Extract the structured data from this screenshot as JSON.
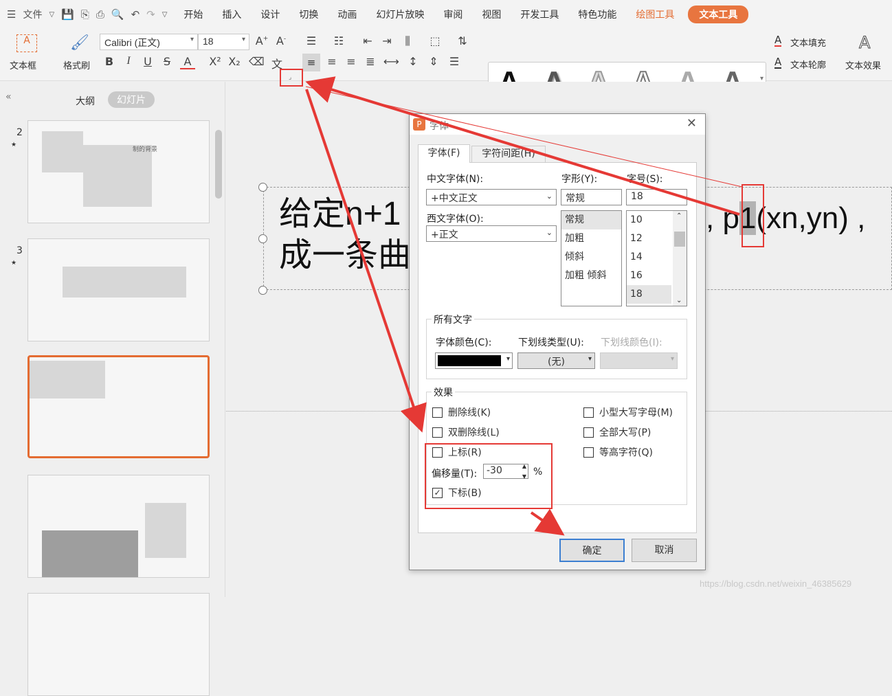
{
  "menu": {
    "file_label": "文件",
    "tabs": [
      "开始",
      "插入",
      "设计",
      "切换",
      "动画",
      "幻灯片放映",
      "审阅",
      "视图",
      "开发工具",
      "特色功能"
    ],
    "drawing_tools": "绘图工具",
    "text_tools": "文本工具"
  },
  "ribbon": {
    "textbox_label": "文本框",
    "format_painter_label": "格式刷",
    "font_name": "Calibri (正文)",
    "font_size": "18",
    "text_fill_label": "文本填充",
    "text_outline_label": "文本轮廓",
    "text_effect_label": "文本效果",
    "gallery_glyph": "A"
  },
  "sidebar": {
    "tab_outline": "大纲",
    "tab_slides": "幻灯片",
    "slide_numbers": [
      "2",
      "3"
    ],
    "thumb_caption": "制的背景"
  },
  "slide": {
    "line1": "给定n+1",
    "line1_tail": ", p",
    "line1_sub": "1",
    "line1_end": "(xn,yn) ,",
    "line2": "成一条曲"
  },
  "dialog": {
    "title": "字体",
    "tabs": [
      "字体(F)",
      "字符间距(H)"
    ],
    "cn_font_label": "中文字体(N):",
    "cn_font_value": "+中文正文",
    "west_font_label": "西文字体(O):",
    "west_font_value": "+正文",
    "style_label": "字形(Y):",
    "style_value": "常规",
    "style_options": [
      "常规",
      "加粗",
      "倾斜",
      "加粗 倾斜"
    ],
    "size_label": "字号(S):",
    "size_value": "18",
    "size_options": [
      "10",
      "12",
      "14",
      "16",
      "18"
    ],
    "all_text_label": "所有文字",
    "font_color_label": "字体颜色(C):",
    "underline_type_label": "下划线类型(U):",
    "underline_type_value": "(无)",
    "underline_color_label": "下划线颜色(I):",
    "effects_label": "效果",
    "strikethrough": "删除线(K)",
    "double_strikethrough": "双删除线(L)",
    "superscript": "上标(R)",
    "offset_label": "偏移量(T):",
    "offset_value": "-30",
    "offset_unit": "%",
    "subscript": "下标(B)",
    "small_caps": "小型大写字母(M)",
    "all_caps": "全部大写(P)",
    "equal_height": "等高字符(Q)",
    "ok": "确定",
    "cancel": "取消"
  },
  "watermark": "https://blog.csdn.net/weixin_46385629",
  "colors": {
    "accent": "#e8753f",
    "annotation": "#e53935",
    "font_color": "#000000"
  }
}
